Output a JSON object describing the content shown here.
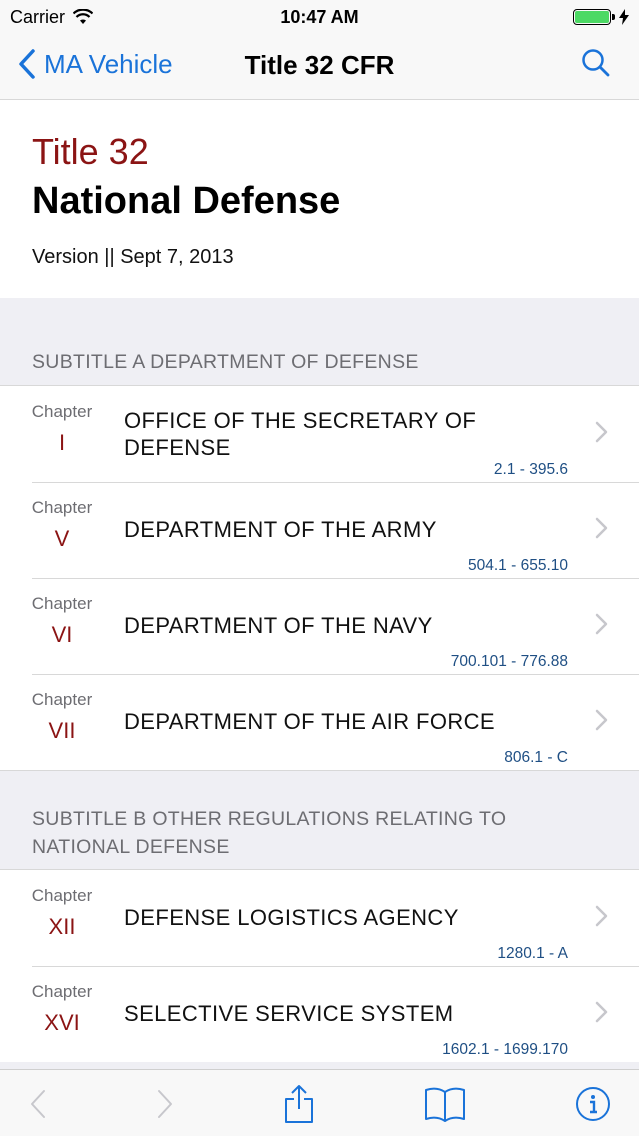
{
  "status_bar": {
    "carrier": "Carrier",
    "time": "10:47 AM"
  },
  "nav": {
    "back_label": "MA Vehicle",
    "title": "Title 32 CFR"
  },
  "header": {
    "title_number": "Title 32",
    "title_name": "National Defense",
    "version": "Version || Sept 7, 2013"
  },
  "sections": [
    {
      "header": "SUBTITLE A DEPARTMENT OF DEFENSE",
      "chapters": [
        {
          "label": "Chapter",
          "number": "I",
          "title": "OFFICE OF THE SECRETARY OF DEFENSE",
          "range": "2.1 - 395.6"
        },
        {
          "label": "Chapter",
          "number": "V",
          "title": "DEPARTMENT OF THE ARMY",
          "range": "504.1 - 655.10"
        },
        {
          "label": "Chapter",
          "number": "VI",
          "title": "DEPARTMENT OF THE NAVY",
          "range": "700.101 - 776.88"
        },
        {
          "label": "Chapter",
          "number": "VII",
          "title": "DEPARTMENT OF THE AIR FORCE",
          "range": "806.1 - C"
        }
      ]
    },
    {
      "header": "SUBTITLE B OTHER REGULATIONS RELATING TO NATIONAL DEFENSE",
      "chapters": [
        {
          "label": "Chapter",
          "number": "XII",
          "title": "DEFENSE LOGISTICS AGENCY",
          "range": "1280.1 - A"
        },
        {
          "label": "Chapter",
          "number": "XVI",
          "title": "SELECTIVE SERVICE SYSTEM",
          "range": "1602.1 - 1699.170"
        }
      ]
    }
  ],
  "toolbar": {
    "items": [
      "chevron-left-icon",
      "chevron-right-icon",
      "share-icon",
      "book-icon",
      "info-icon"
    ]
  },
  "colors": {
    "accent": "#1a73d9",
    "chapter_red": "#8b1414",
    "range_blue": "#1f4f84",
    "battery_green": "#4cd964"
  }
}
